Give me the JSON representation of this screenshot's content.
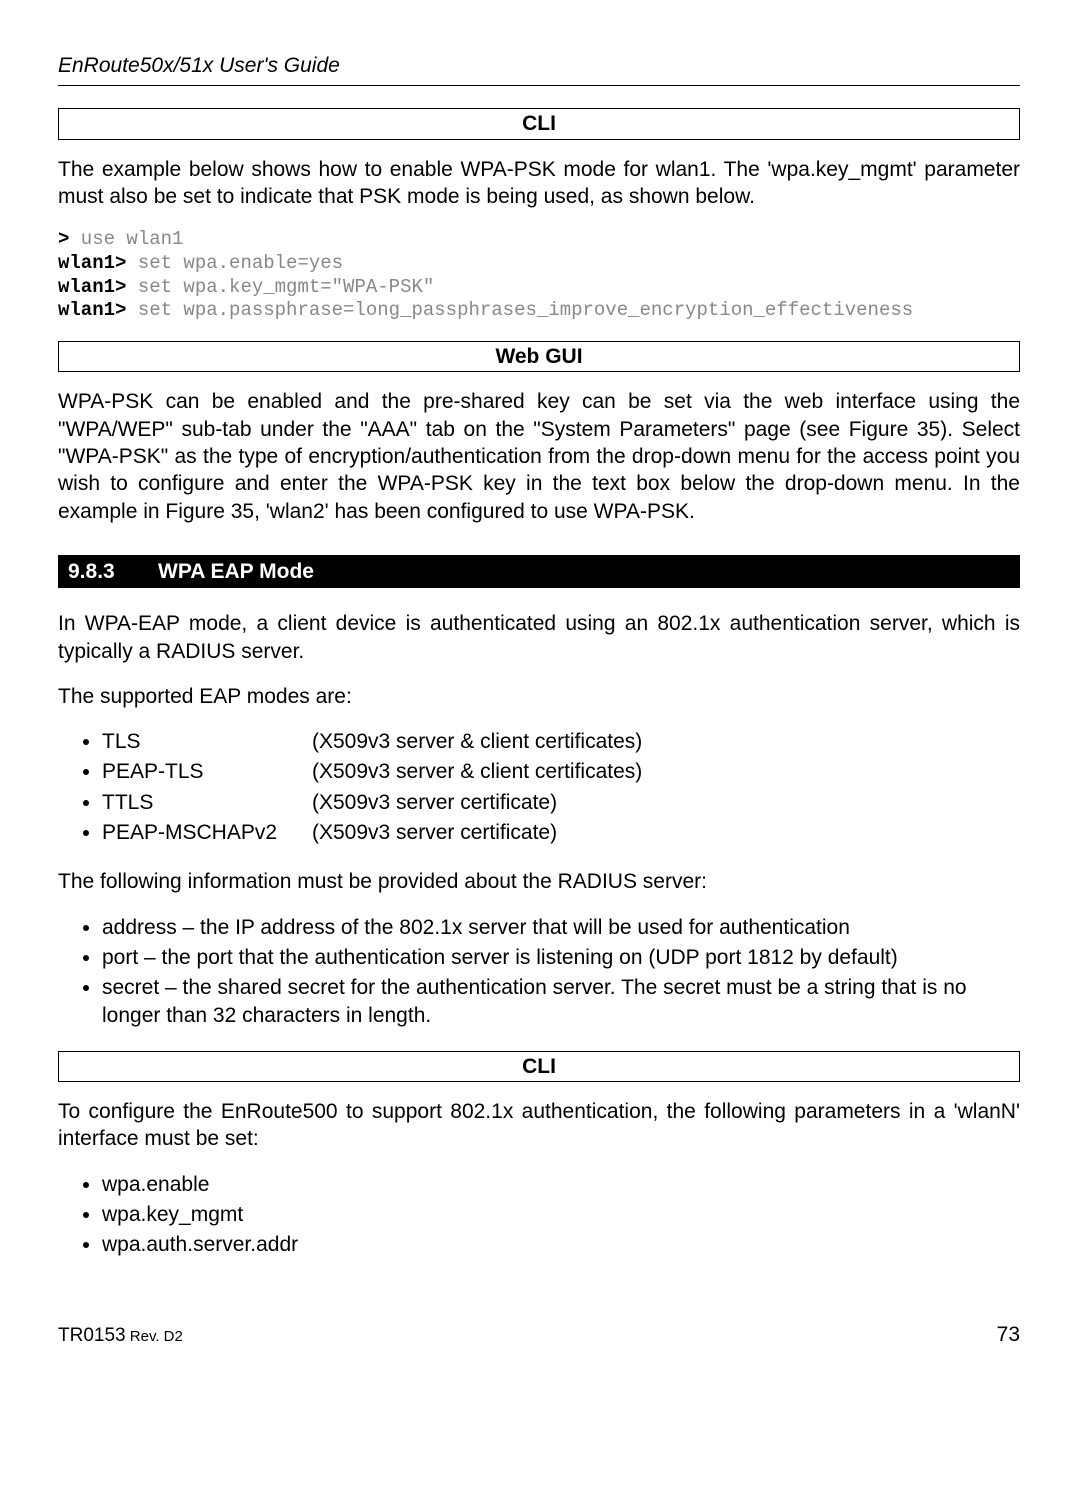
{
  "header": {
    "title": "EnRoute50x/51x User's Guide"
  },
  "cli1": {
    "label": "CLI",
    "intro": "The example below shows how to enable WPA-PSK mode for wlan1. The 'wpa.key_mgmt' parameter must also be set to indicate that PSK mode is being used, as shown below.",
    "prompt1": ">",
    "cmd1": " use wlan1",
    "prompt2": "wlan1>",
    "cmd2": " set wpa.enable=yes",
    "prompt3": "wlan1>",
    "cmd3": " set wpa.key_mgmt=\"WPA-PSK\"",
    "prompt4": "wlan1>",
    "cmd4": " set wpa.passphrase=long_passphrases_improve_encryption_effectiveness"
  },
  "webgui": {
    "label": "Web GUI",
    "para": "WPA-PSK can be enabled and the pre-shared key can be set via the web interface using the \"WPA/WEP\" sub-tab under the \"AAA\" tab on the \"System Parameters\" page (see Figure 35). Select \"WPA-PSK\" as the type of encryption/authentication from the drop-down menu for the access point you wish to configure and enter the WPA-PSK key in the text box below the drop-down menu. In the example in Figure 35, 'wlan2' has been configured to use WPA-PSK."
  },
  "section": {
    "number": "9.8.3",
    "title": "WPA EAP Mode"
  },
  "eap": {
    "intro": "In WPA-EAP mode, a client device is authenticated using an 802.1x authentication server, which is typically a RADIUS server.",
    "supported_label": "The supported EAP modes are:",
    "modes": {
      "m1_name": "TLS",
      "m1_cert": "(X509v3 server & client certificates)",
      "m2_name": "PEAP-TLS",
      "m2_cert": "(X509v3 server & client certificates)",
      "m3_name": "TTLS",
      "m3_cert": "(X509v3 server certificate)",
      "m4_name": "PEAP-MSCHAPv2",
      "m4_cert": "(X509v3 server certificate)"
    },
    "radius_label": "The following information must be provided about the RADIUS server:",
    "radius": {
      "r1": "address – the IP address of the 802.1x server that will be used for authentication",
      "r2": "port – the port that the authentication server is listening on (UDP port 1812 by default)",
      "r3": "secret – the shared secret for the authentication server. The secret must be a string that is no longer than 32 characters in length."
    }
  },
  "cli2": {
    "label": "CLI",
    "intro": "To configure the EnRoute500 to support 802.1x authentication, the following parameters in a 'wlanN' interface must be set:",
    "params": {
      "p1": "wpa.enable",
      "p2": "wpa.key_mgmt",
      "p3": "wpa.auth.server.addr"
    }
  },
  "footer": {
    "doc": "TR0153",
    "rev": " Rev. D2",
    "page": "73"
  }
}
